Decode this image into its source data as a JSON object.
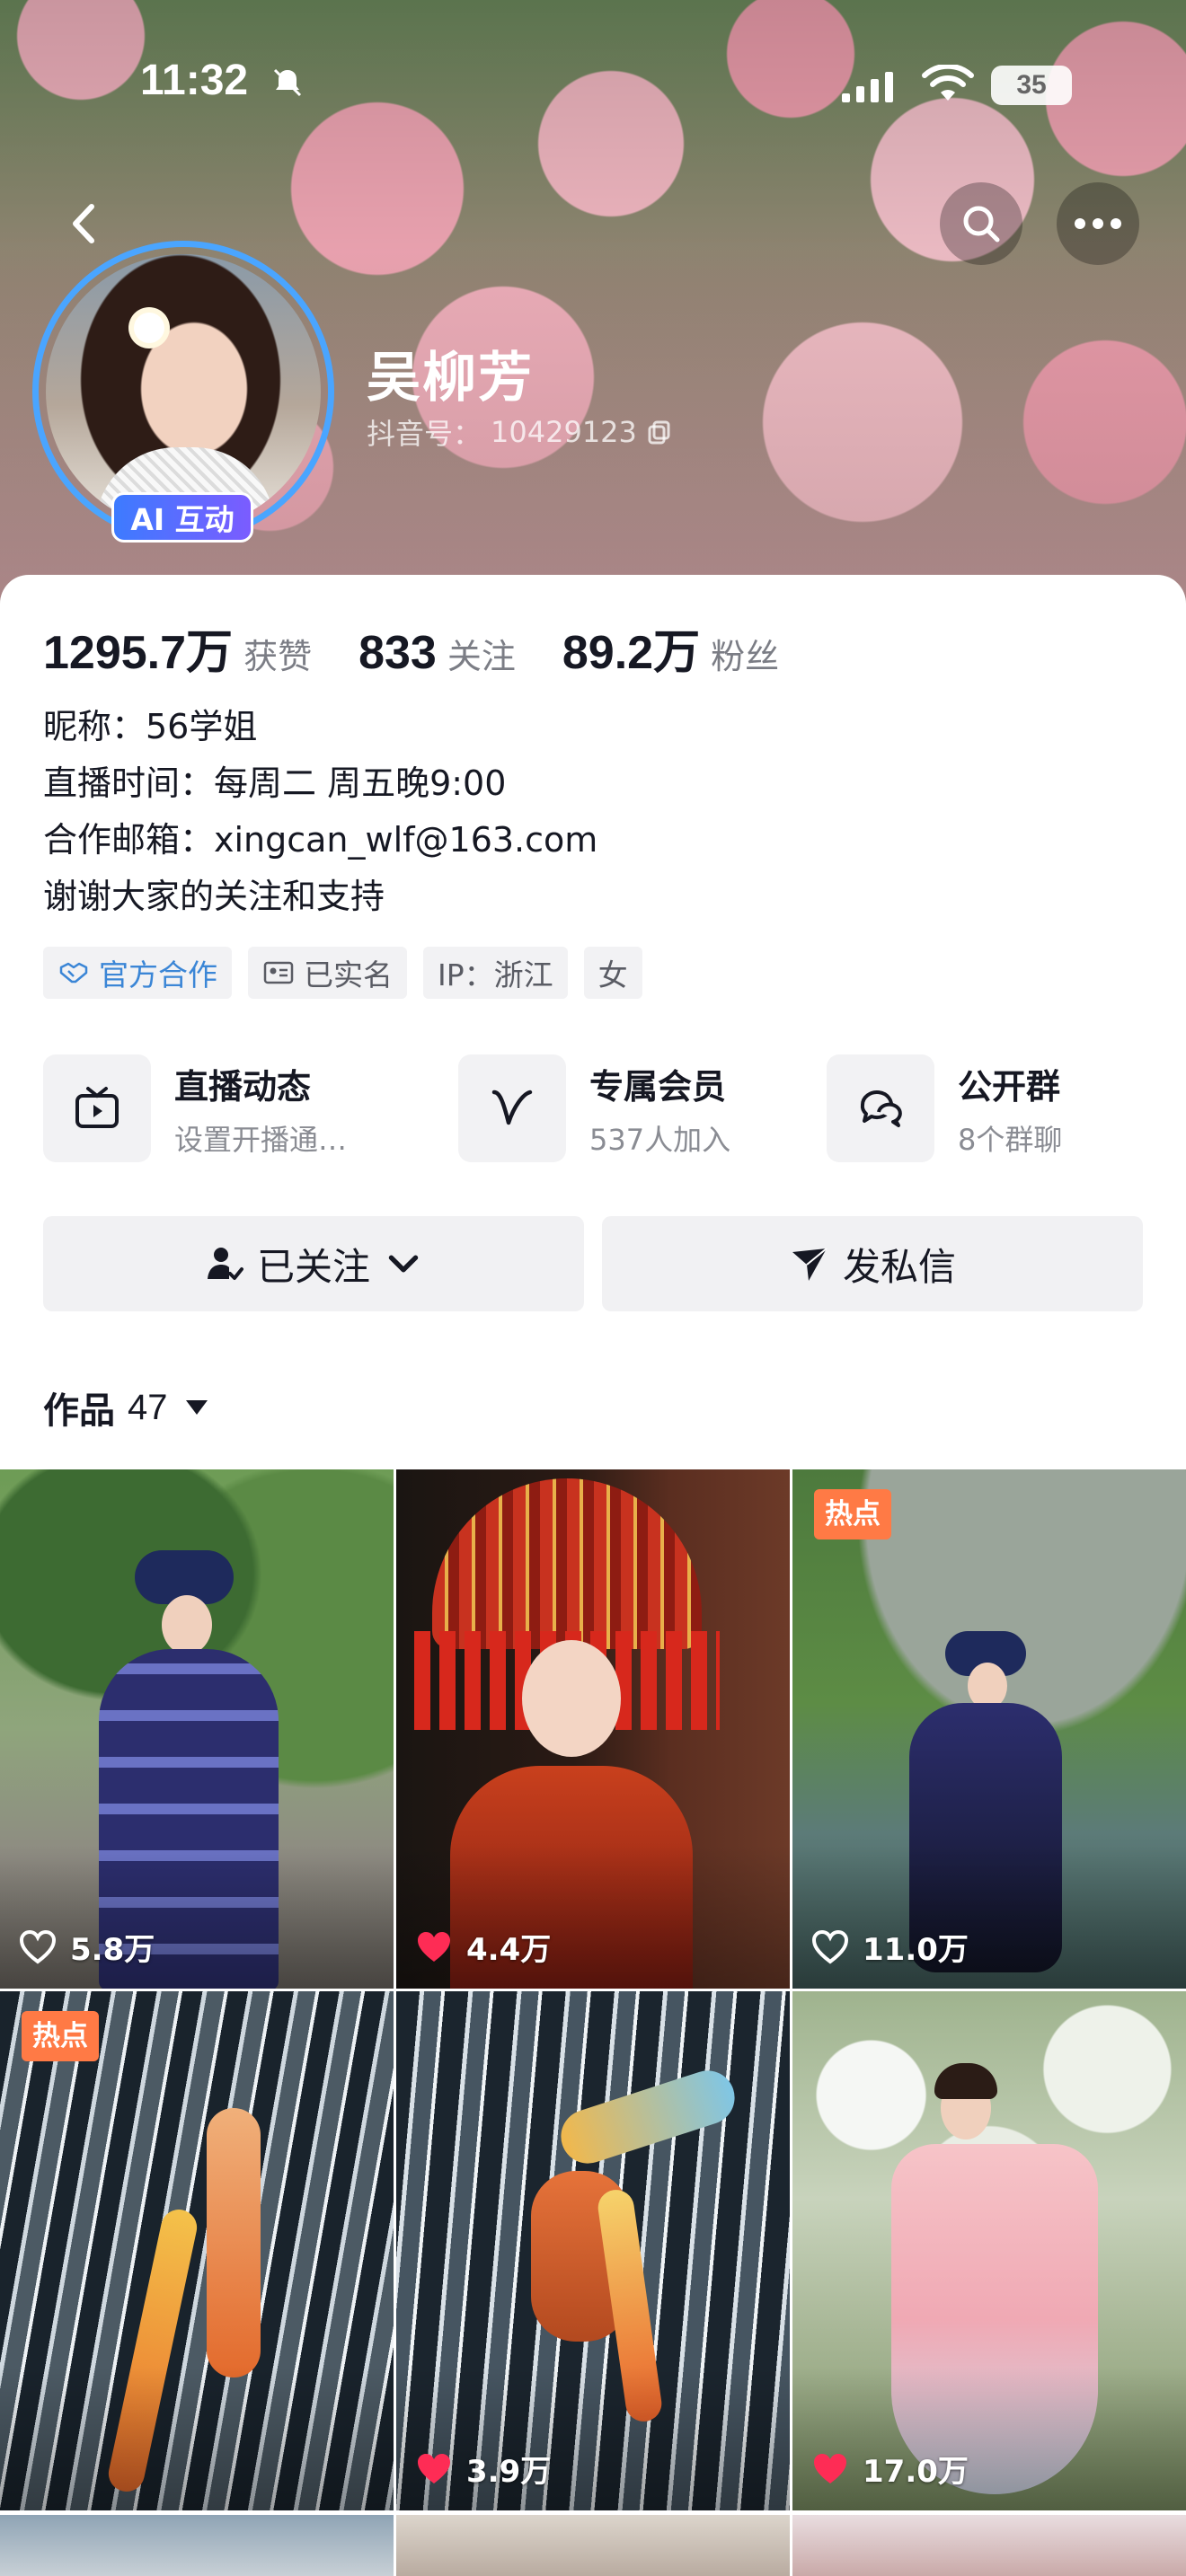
{
  "status_bar": {
    "time": "11:32",
    "battery": "35"
  },
  "profile": {
    "name": "吴柳芳",
    "douyin_id_label": "抖音号：",
    "douyin_id": "10429123",
    "ai_badge": "AI 互动"
  },
  "stats": [
    {
      "value": "1295.7万",
      "label": "获赞"
    },
    {
      "value": "833",
      "label": "关注"
    },
    {
      "value": "89.2万",
      "label": "粉丝"
    }
  ],
  "bio": {
    "line1": "昵称：56学姐",
    "line2": "直播时间：每周二 周五晚9:00",
    "line3": "合作邮箱：xingcan_wlf@163.com",
    "line4": "谢谢大家的关注和支持"
  },
  "tags": {
    "official": "官方合作",
    "verified": "已实名",
    "ip": "IP：浙江",
    "gender": "女"
  },
  "features": [
    {
      "title": "直播动态",
      "subtitle": "设置开播通…",
      "icon": "tv-icon"
    },
    {
      "title": "专属会员",
      "subtitle": "537人加入",
      "icon": "v-icon"
    },
    {
      "title": "公开群",
      "subtitle": "8个群聊",
      "icon": "chat-icon"
    }
  ],
  "actions": {
    "following": "已关注",
    "message": "发私信"
  },
  "works": {
    "label": "作品",
    "count": "47"
  },
  "posts": [
    {
      "likes": "5.8万",
      "liked": false,
      "hot": ""
    },
    {
      "likes": "4.4万",
      "liked": true,
      "hot": ""
    },
    {
      "likes": "11.0万",
      "liked": false,
      "hot": "热点"
    },
    {
      "likes": "",
      "liked": false,
      "hot": "热点"
    },
    {
      "likes": "3.9万",
      "liked": true,
      "hot": ""
    },
    {
      "likes": "17.0万",
      "liked": true,
      "hot": ""
    }
  ],
  "colors": {
    "accent_blue": "#4aa5ff",
    "liked_red": "#fe2c55",
    "hot_orange": "#ff7a45",
    "official_blue": "#3b86d6"
  }
}
